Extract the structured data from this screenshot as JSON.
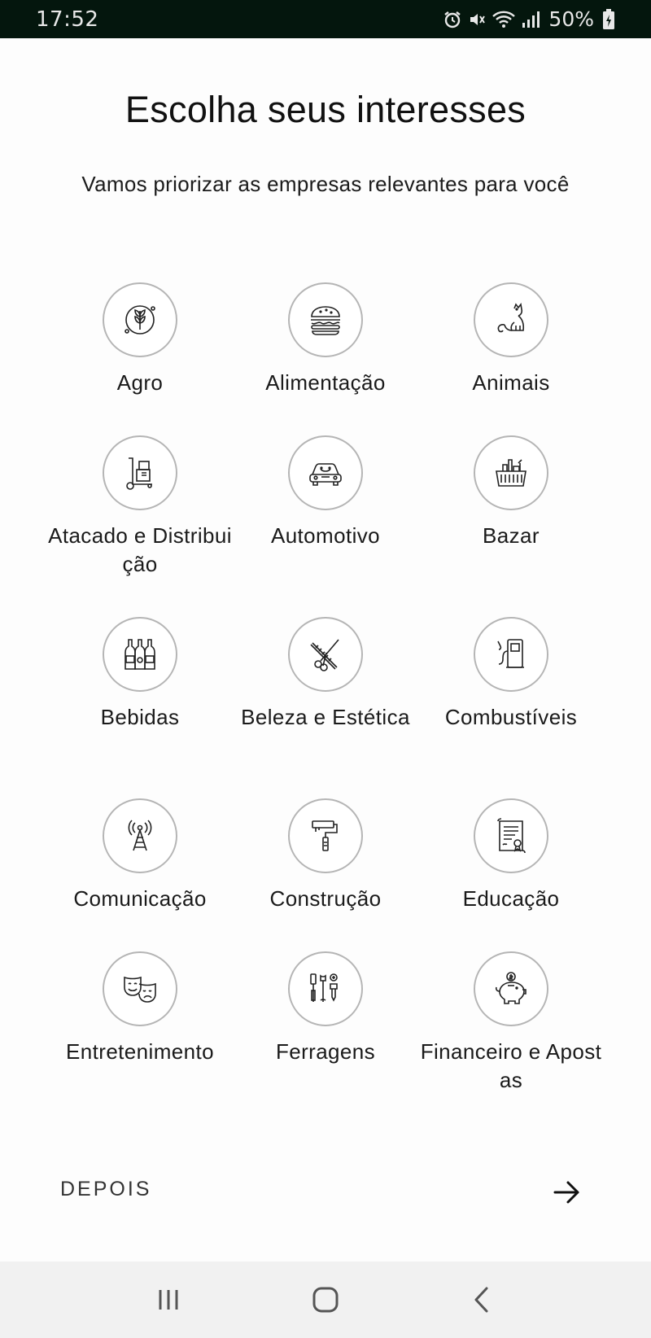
{
  "status_bar": {
    "time": "17:52",
    "battery": "50%",
    "icons": [
      "alarm-icon",
      "mute-icon",
      "wifi-icon",
      "signal-icon",
      "battery-icon"
    ]
  },
  "page": {
    "title": "Escolha seus interesses",
    "subtitle": "Vamos priorizar as empresas relevantes para você"
  },
  "categories": [
    {
      "label": "Agro",
      "icon": "wheat-icon"
    },
    {
      "label": "Alimentação",
      "icon": "burger-icon"
    },
    {
      "label": "Animais",
      "icon": "cat-icon"
    },
    {
      "label": "Atacado e Distribuição",
      "icon": "hand-truck-icon"
    },
    {
      "label": "Automotivo",
      "icon": "car-icon"
    },
    {
      "label": "Bazar",
      "icon": "basket-icon"
    },
    {
      "label": "Bebidas",
      "icon": "bottles-icon"
    },
    {
      "label": "Beleza e Estética",
      "icon": "scissors-comb-icon"
    },
    {
      "label": "Combustíveis",
      "icon": "fuel-pump-icon"
    },
    {
      "label": "Comunicação",
      "icon": "antenna-tower-icon"
    },
    {
      "label": "Construção",
      "icon": "paint-roller-icon"
    },
    {
      "label": "Educação",
      "icon": "diploma-icon"
    },
    {
      "label": "Entretenimento",
      "icon": "theater-masks-icon"
    },
    {
      "label": "Ferragens",
      "icon": "tools-icon"
    },
    {
      "label": "Financeiro e Apostas",
      "icon": "piggy-bank-icon"
    }
  ],
  "footer": {
    "later_label": "DEPOIS",
    "next_icon": "arrow-right-icon"
  },
  "nav_bar": {
    "buttons": [
      "recent-apps-icon",
      "home-icon",
      "back-icon"
    ]
  },
  "colors": {
    "status_bar_bg": "#04160d",
    "circle_border": "#b5b5b5",
    "nav_bar_bg": "#f1f1f1"
  }
}
